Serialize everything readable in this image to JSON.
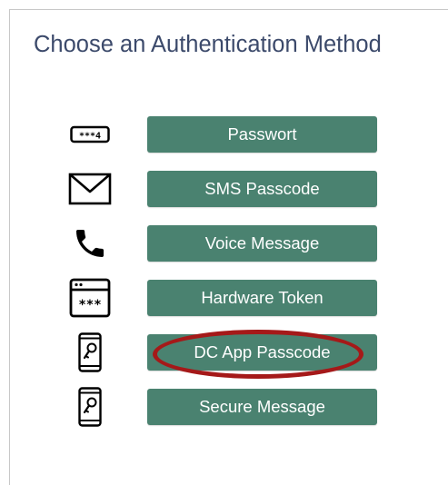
{
  "header": {
    "title": "Choose an Authentication Method"
  },
  "methods": [
    {
      "label": "Passwort",
      "icon": "password-field-icon"
    },
    {
      "label": "SMS Passcode",
      "icon": "envelope-icon"
    },
    {
      "label": "Voice Message",
      "icon": "phone-icon"
    },
    {
      "label": "Hardware Token",
      "icon": "hardware-token-icon"
    },
    {
      "label": "DC App Passcode",
      "icon": "phone-key-icon",
      "highlighted": true
    },
    {
      "label": "Secure Message",
      "icon": "phone-key-icon"
    }
  ],
  "colors": {
    "button_background": "#4a8270",
    "button_text": "#ffffff",
    "title_text": "#3c4a6b",
    "highlight_ring": "#a51919"
  }
}
